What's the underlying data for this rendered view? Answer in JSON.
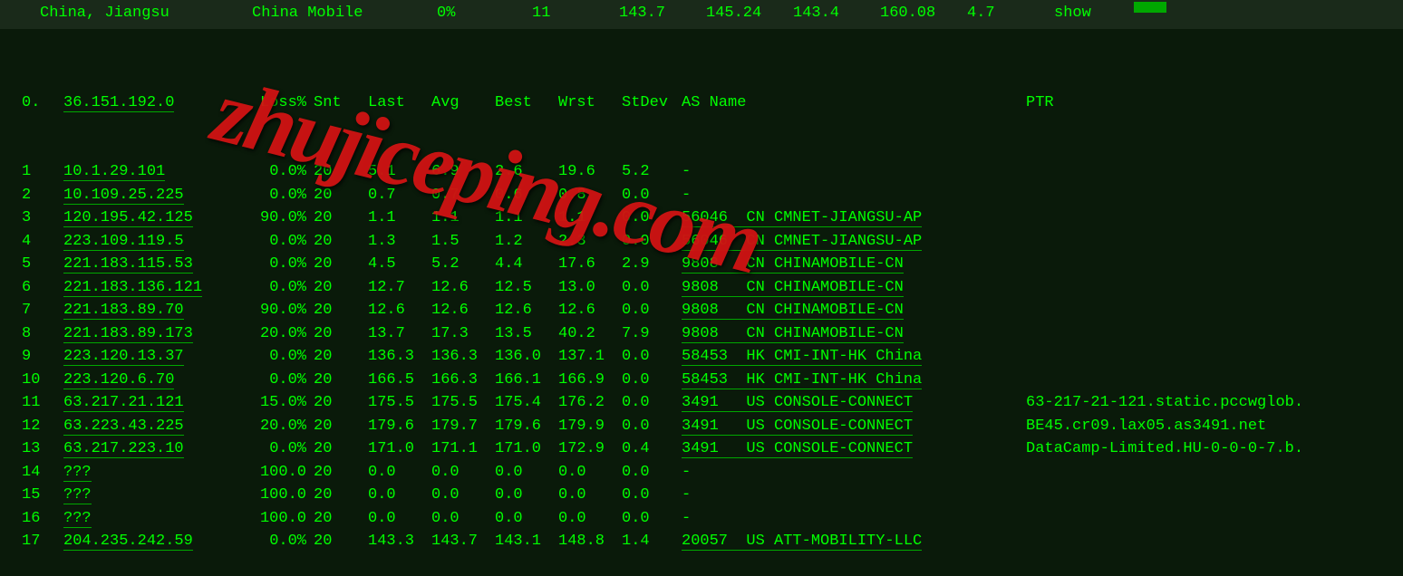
{
  "header": {
    "location": "China, Jiangsu",
    "isp": "China Mobile",
    "loss": "0%",
    "hops": "11",
    "v1": "143.7",
    "v2": "145.24",
    "v3": "143.4",
    "v4": "160.08",
    "v5": "4.7",
    "show": "show"
  },
  "columns": {
    "hop": "0.",
    "ip": "36.151.192.0",
    "loss": "Loss%",
    "snt": "Snt",
    "last": "Last",
    "avg": "Avg",
    "best": "Best",
    "wrst": "Wrst",
    "stdev": "StDev",
    "as": "AS Name",
    "ptr": "PTR"
  },
  "rows": [
    {
      "hop": "1",
      "ip": "10.1.29.101",
      "loss": "0.0%",
      "snt": "20",
      "last": "5.1",
      "avg": "6.9",
      "best": "2.6",
      "wrst": "19.6",
      "stdev": "5.2",
      "as": "-",
      "ptr": ""
    },
    {
      "hop": "2",
      "ip": "10.109.25.225",
      "loss": "0.0%",
      "snt": "20",
      "last": "0.7",
      "avg": "0.7",
      "best": "0.6",
      "wrst": "0.8",
      "stdev": "0.0",
      "as": "-",
      "ptr": ""
    },
    {
      "hop": "3",
      "ip": "120.195.42.125",
      "loss": "90.0%",
      "snt": "20",
      "last": "1.1",
      "avg": "1.1",
      "best": "1.1",
      "wrst": "1.1",
      "stdev": "0.0",
      "as": "56046  CN CMNET-JIANGSU-AP",
      "ptr": ""
    },
    {
      "hop": "4",
      "ip": "223.109.119.5",
      "loss": "0.0%",
      "snt": "20",
      "last": "1.3",
      "avg": "1.5",
      "best": "1.2",
      "wrst": "2.3",
      "stdev": "0.0",
      "as": "56046  CN CMNET-JIANGSU-AP",
      "ptr": ""
    },
    {
      "hop": "5",
      "ip": "221.183.115.53",
      "loss": "0.0%",
      "snt": "20",
      "last": "4.5",
      "avg": "5.2",
      "best": "4.4",
      "wrst": "17.6",
      "stdev": "2.9",
      "as": "9808   CN CHINAMOBILE-CN",
      "ptr": ""
    },
    {
      "hop": "6",
      "ip": "221.183.136.121",
      "loss": "0.0%",
      "snt": "20",
      "last": "12.7",
      "avg": "12.6",
      "best": "12.5",
      "wrst": "13.0",
      "stdev": "0.0",
      "as": "9808   CN CHINAMOBILE-CN",
      "ptr": ""
    },
    {
      "hop": "7",
      "ip": "221.183.89.70",
      "loss": "90.0%",
      "snt": "20",
      "last": "12.6",
      "avg": "12.6",
      "best": "12.6",
      "wrst": "12.6",
      "stdev": "0.0",
      "as": "9808   CN CHINAMOBILE-CN",
      "ptr": ""
    },
    {
      "hop": "8",
      "ip": "221.183.89.173",
      "loss": "20.0%",
      "snt": "20",
      "last": "13.7",
      "avg": "17.3",
      "best": "13.5",
      "wrst": "40.2",
      "stdev": "7.9",
      "as": "9808   CN CHINAMOBILE-CN",
      "ptr": ""
    },
    {
      "hop": "9",
      "ip": "223.120.13.37",
      "loss": "0.0%",
      "snt": "20",
      "last": "136.3",
      "avg": "136.3",
      "best": "136.0",
      "wrst": "137.1",
      "stdev": "0.0",
      "as": "58453  HK CMI-INT-HK China",
      "ptr": ""
    },
    {
      "hop": "10",
      "ip": "223.120.6.70",
      "loss": "0.0%",
      "snt": "20",
      "last": "166.5",
      "avg": "166.3",
      "best": "166.1",
      "wrst": "166.9",
      "stdev": "0.0",
      "as": "58453  HK CMI-INT-HK China",
      "ptr": ""
    },
    {
      "hop": "11",
      "ip": "63.217.21.121",
      "loss": "15.0%",
      "snt": "20",
      "last": "175.5",
      "avg": "175.5",
      "best": "175.4",
      "wrst": "176.2",
      "stdev": "0.0",
      "as": "3491   US CONSOLE-CONNECT",
      "ptr": "63-217-21-121.static.pccwglob."
    },
    {
      "hop": "12",
      "ip": "63.223.43.225",
      "loss": "20.0%",
      "snt": "20",
      "last": "179.6",
      "avg": "179.7",
      "best": "179.6",
      "wrst": "179.9",
      "stdev": "0.0",
      "as": "3491   US CONSOLE-CONNECT",
      "ptr": "BE45.cr09.lax05.as3491.net"
    },
    {
      "hop": "13",
      "ip": "63.217.223.10",
      "loss": "0.0%",
      "snt": "20",
      "last": "171.0",
      "avg": "171.1",
      "best": "171.0",
      "wrst": "172.9",
      "stdev": "0.4",
      "as": "3491   US CONSOLE-CONNECT",
      "ptr": "DataCamp-Limited.HU-0-0-0-7.b."
    },
    {
      "hop": "14",
      "ip": "???",
      "loss": "100.0",
      "snt": "20",
      "last": "0.0",
      "avg": "0.0",
      "best": "0.0",
      "wrst": "0.0",
      "stdev": "0.0",
      "as": "-",
      "ptr": ""
    },
    {
      "hop": "15",
      "ip": "???",
      "loss": "100.0",
      "snt": "20",
      "last": "0.0",
      "avg": "0.0",
      "best": "0.0",
      "wrst": "0.0",
      "stdev": "0.0",
      "as": "-",
      "ptr": ""
    },
    {
      "hop": "16",
      "ip": "???",
      "loss": "100.0",
      "snt": "20",
      "last": "0.0",
      "avg": "0.0",
      "best": "0.0",
      "wrst": "0.0",
      "stdev": "0.0",
      "as": "-",
      "ptr": ""
    },
    {
      "hop": "17",
      "ip": "204.235.242.59",
      "loss": "0.0%",
      "snt": "20",
      "last": "143.3",
      "avg": "143.7",
      "best": "143.1",
      "wrst": "148.8",
      "stdev": "1.4",
      "as": "20057  US ATT-MOBILITY-LLC",
      "ptr": ""
    }
  ],
  "watermark": "zhujiceping.com"
}
